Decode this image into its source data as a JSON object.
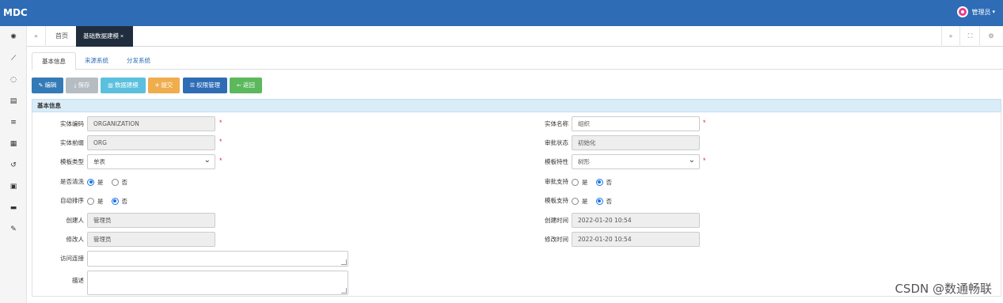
{
  "app": {
    "logo": "MDC",
    "user_label": "管理员",
    "user_caret": "▾"
  },
  "sidebar": {
    "icons": [
      "dashboard-icon",
      "chart-icon",
      "spinner-icon",
      "database-icon",
      "list-icon",
      "table-icon",
      "history-icon",
      "film-icon",
      "archive-icon",
      "wrench-icon"
    ]
  },
  "tabs": {
    "prev_label": "«",
    "home_label": "首页",
    "active_label": "基础数据建模",
    "close_label": "×",
    "next_label": "»",
    "fullscreen_label": "⛶",
    "settings_label": "⚙"
  },
  "subtabs": [
    "基本信息",
    "来源系统",
    "分发系统"
  ],
  "toolbar": {
    "edit": {
      "icon": "✎",
      "label": "编辑",
      "color": "#337ab7"
    },
    "save": {
      "icon": "⤓",
      "label": "保存",
      "color": "#b5bcc2"
    },
    "model": {
      "icon": "▥",
      "label": "数据建模",
      "color": "#5bc0de"
    },
    "submit": {
      "icon": "✈",
      "label": "提交",
      "color": "#f0ad4e"
    },
    "perm": {
      "icon": "☰",
      "label": "权限管理",
      "color": "#2e6cb6"
    },
    "back": {
      "icon": "←",
      "label": "返回",
      "color": "#5cb85c"
    }
  },
  "section": {
    "title": "基本信息"
  },
  "form": {
    "entity_code": {
      "label": "实体编码",
      "value": "ORGANIZATION"
    },
    "entity_prefix": {
      "label": "实体前缀",
      "value": "ORG"
    },
    "template_type": {
      "label": "模板类型",
      "value": "单表"
    },
    "need_clean": {
      "label": "是否清洗",
      "yes": "是",
      "no": "否",
      "selected": "yes"
    },
    "auto_sort": {
      "label": "自动排序",
      "yes": "是",
      "no": "否",
      "selected": "no"
    },
    "creator": {
      "label": "创建人",
      "value": "管理员"
    },
    "modifier": {
      "label": "修改人",
      "value": "管理员"
    },
    "access_link": {
      "label": "访问连接",
      "value": ""
    },
    "description": {
      "label": "描述",
      "value": ""
    },
    "entity_name": {
      "label": "实体名称",
      "value": "组织"
    },
    "approval_status": {
      "label": "审批状态",
      "value": "初始化"
    },
    "template_feature": {
      "label": "模板特性",
      "value": "树形"
    },
    "approval_support": {
      "label": "审批支持",
      "yes": "是",
      "no": "否",
      "selected": "no"
    },
    "template_support": {
      "label": "模板支持",
      "yes": "是",
      "no": "否",
      "selected": "no"
    },
    "create_time": {
      "label": "创建时间",
      "value": "2022-01-20 10:54"
    },
    "modify_time": {
      "label": "修改时间",
      "value": "2022-01-20 10:54"
    },
    "required_mark": "*"
  },
  "watermark": "CSDN @数通畅联"
}
